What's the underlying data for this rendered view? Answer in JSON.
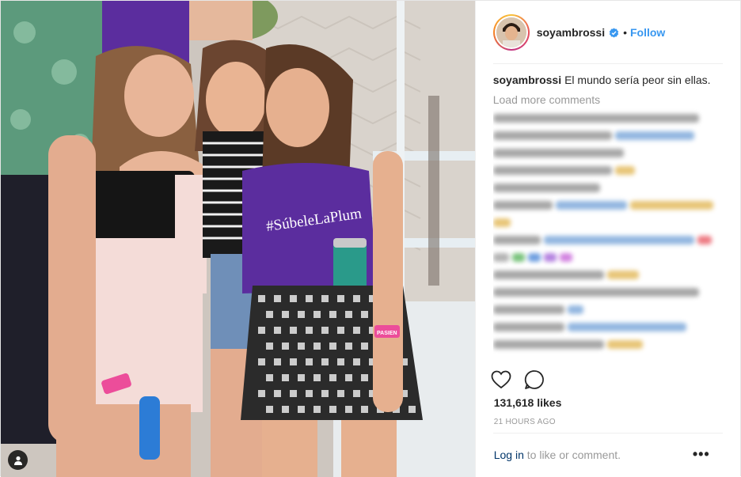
{
  "post": {
    "username": "soyambrossi",
    "follow_label": "Follow",
    "separator": "•",
    "caption": {
      "username": "soyambrossi",
      "text": "El mundo sería peor sin ellas."
    },
    "load_more_label": "Load more comments",
    "likes_label": "131,618 likes",
    "timestamp": "21 HOURS AGO",
    "login_link": "Log in",
    "login_suffix": "to like or comment.",
    "more_options": "•••",
    "photo_shirt_text": "#SúbeleLaPlum",
    "wristband_text": "PASIEN",
    "icons": {
      "verified": "verified-badge-icon",
      "like": "heart-icon",
      "comment": "comment-bubble-icon",
      "tag": "tagged-user-icon"
    },
    "colors": {
      "accent": "#3897f0",
      "link": "#003569",
      "muted": "#999999",
      "shirt": "#5b2d9e"
    }
  }
}
